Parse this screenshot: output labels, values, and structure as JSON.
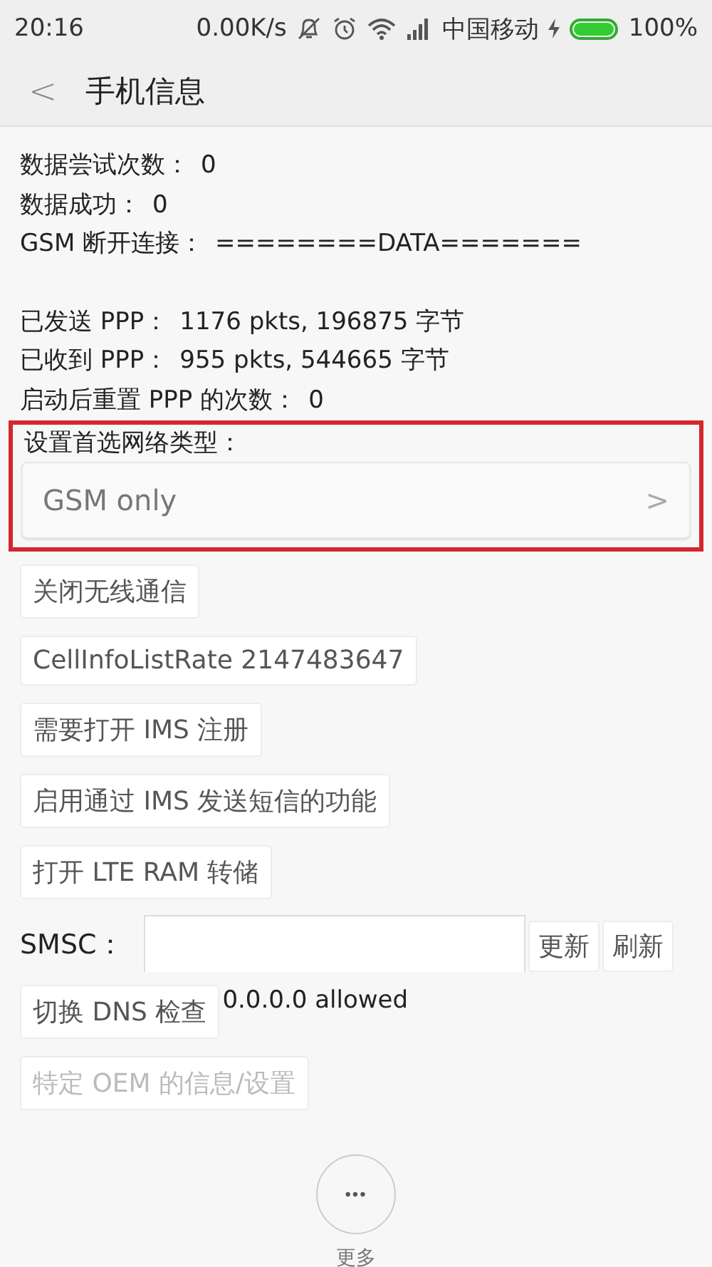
{
  "status_bar": {
    "time": "20:16",
    "speed": "0.00K/s",
    "carrier": "中国移动",
    "battery": "100%"
  },
  "header": {
    "back": "<",
    "title": "手机信息"
  },
  "info_groups": [
    [
      {
        "label": "数据尝试次数：",
        "value": "0"
      },
      {
        "label": "数据成功：",
        "value": "0"
      },
      {
        "label": "GSM 断开连接：",
        "value": "========DATA======="
      }
    ],
    [
      {
        "label": "已发送 PPP：",
        "value": "1176 pkts, 196875 字节"
      },
      {
        "label": "已收到 PPP：",
        "value": "955 pkts, 544665 字节"
      },
      {
        "label": "启动后重置 PPP 的次数：",
        "value": "0"
      }
    ]
  ],
  "network_type": {
    "label": "设置首选网络类型：",
    "value": "GSM only",
    "chevron": ">",
    "highlighted": true
  },
  "buttons": [
    {
      "label": "关闭无线通信",
      "disabled": false
    },
    {
      "label": "CellInfoListRate 2147483647",
      "disabled": false
    },
    {
      "label": "需要打开 IMS 注册",
      "disabled": false
    },
    {
      "label": "启用通过 IMS 发送短信的功能",
      "disabled": false
    },
    {
      "label": "打开 LTE RAM 转储",
      "disabled": false
    }
  ],
  "smsc": {
    "label": "SMSC：",
    "update": "更新",
    "refresh": "刷新"
  },
  "dns": {
    "button": "切换 DNS 检查",
    "status": "0.0.0.0 allowed"
  },
  "oem": {
    "label": "特定 OEM 的信息/设置",
    "disabled": true
  },
  "more": {
    "icon": "•••",
    "label": "更多"
  }
}
